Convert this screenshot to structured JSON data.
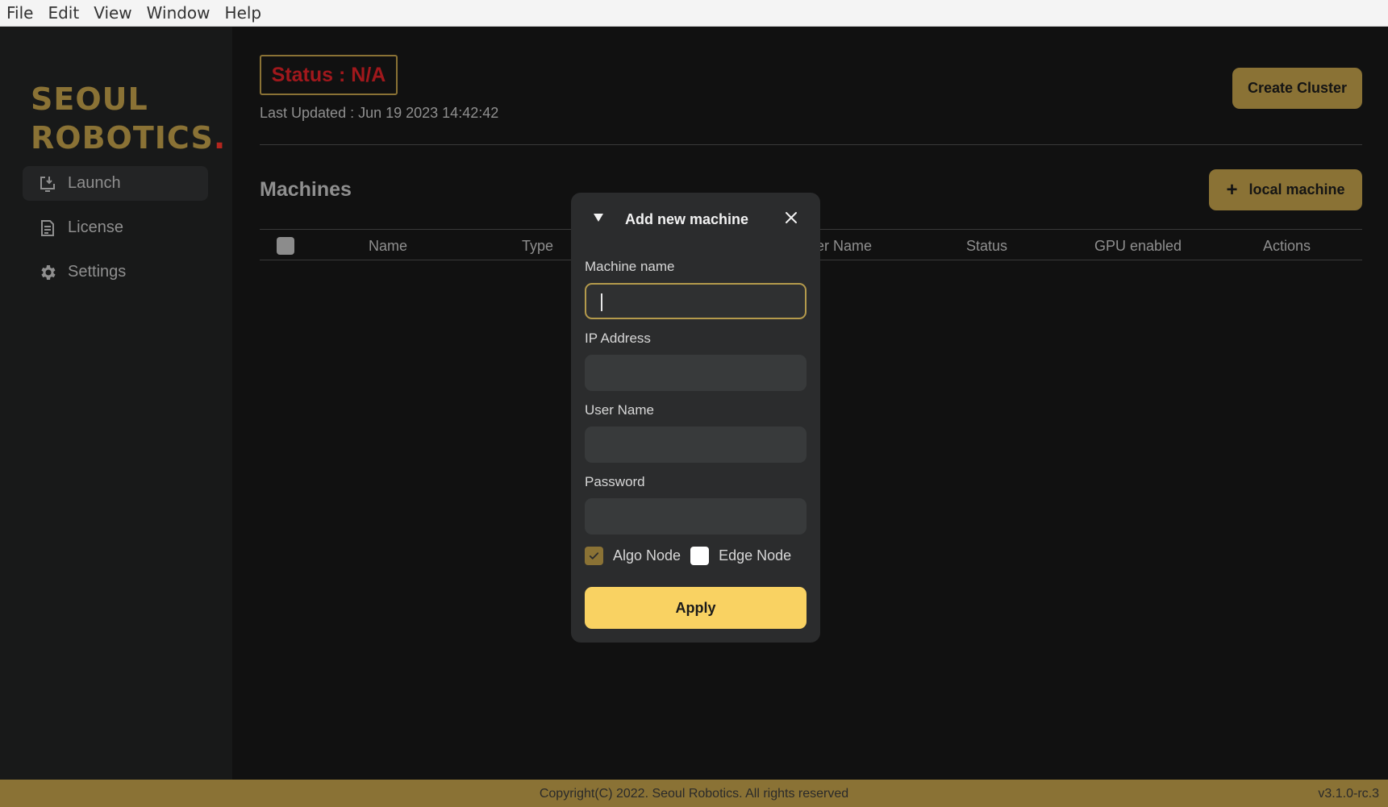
{
  "menubar": {
    "items": [
      "File",
      "Edit",
      "View",
      "Window",
      "Help"
    ]
  },
  "sidebar": {
    "logo_line1": "SEOUL",
    "logo_line2": "ROBOTICS",
    "logo_dot": ".",
    "items": [
      {
        "label": "Launch",
        "icon": "launch-icon",
        "active": true
      },
      {
        "label": "License",
        "icon": "document-icon",
        "active": false
      },
      {
        "label": "Settings",
        "icon": "gear-icon",
        "active": false
      }
    ]
  },
  "main": {
    "status": "Status : N/A",
    "last_updated": "Last Updated : Jun 19 2023 14:42:42",
    "create_cluster_label": "Create Cluster",
    "machines_title": "Machines",
    "local_machine_plus": "+",
    "local_machine_label": "local machine",
    "table_headers": {
      "name": "Name",
      "type": "Type",
      "user_name": "er Name",
      "status": "Status",
      "gpu_enabled": "GPU enabled",
      "actions": "Actions"
    }
  },
  "modal": {
    "title": "Add new machine",
    "fields": {
      "machine_name": {
        "label": "Machine name",
        "value": ""
      },
      "ip_address": {
        "label": "IP Address",
        "value": ""
      },
      "user_name": {
        "label": "User Name",
        "value": ""
      },
      "password": {
        "label": "Password",
        "value": ""
      }
    },
    "algo_node": {
      "label": "Algo Node",
      "checked": true
    },
    "edge_node": {
      "label": "Edge Node",
      "checked": false
    },
    "apply_label": "Apply"
  },
  "footer": {
    "copyright": "Copyright(C) 2022. Seoul Robotics. All rights reserved",
    "version": "v3.1.0-rc.3"
  },
  "colors": {
    "accent": "#8a7235",
    "apply": "#f9d262",
    "status_text": "#a0181c"
  }
}
